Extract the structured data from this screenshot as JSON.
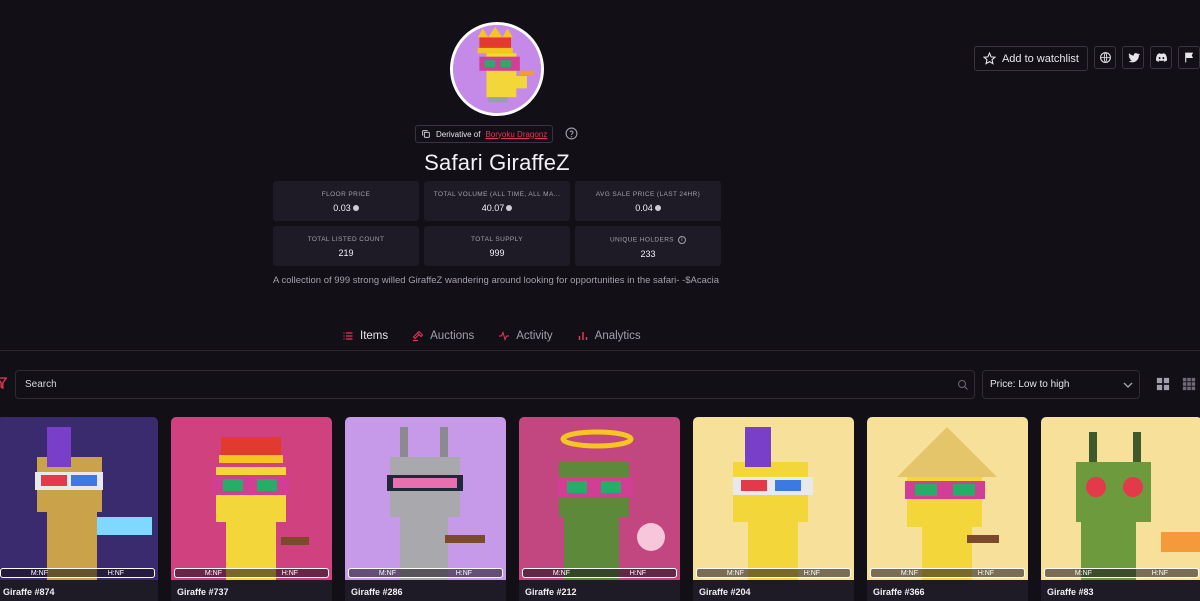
{
  "actions": {
    "watchlist_label": "Add to watchlist",
    "icons": [
      "globe-icon",
      "twitter-icon",
      "discord-icon",
      "flag-icon"
    ]
  },
  "collection": {
    "derivative_prefix": "Derivative of",
    "derivative_link": "Boryoku Dragonz",
    "title": "Safari GiraffeZ",
    "description": "A collection of 999 strong willed GiraffeZ wandering around looking for opportunities in the safari- -$Acacia"
  },
  "stats": [
    {
      "label": "FLOOR PRICE",
      "value": "0.03",
      "currency": true
    },
    {
      "label": "TOTAL VOLUME (ALL TIME, ALL MA...",
      "value": "40.07",
      "currency": true
    },
    {
      "label": "AVG SALE PRICE (LAST 24HR)",
      "value": "0.04",
      "currency": true
    },
    {
      "label": "TOTAL LISTED COUNT",
      "value": "219",
      "currency": false
    },
    {
      "label": "TOTAL SUPPLY",
      "value": "999",
      "currency": false
    },
    {
      "label": "UNIQUE HOLDERS",
      "value": "233",
      "currency": false
    }
  ],
  "tabs": [
    {
      "label": "Items",
      "active": true,
      "icon": "list-icon"
    },
    {
      "label": "Auctions",
      "active": false,
      "icon": "gavel-icon"
    },
    {
      "label": "Activity",
      "active": false,
      "icon": "pulse-icon"
    },
    {
      "label": "Analytics",
      "active": false,
      "icon": "bar-chart-icon"
    }
  ],
  "search": {
    "placeholder": "Search"
  },
  "sort": {
    "selected": "Price: Low to high"
  },
  "cards": [
    {
      "name": "Giraffe #874",
      "m": "M:NF",
      "h": "H:NF",
      "bg": "#3a2a6e",
      "skin": "#c9a24a"
    },
    {
      "name": "Giraffe #737",
      "m": "M:NF",
      "h": "H:NF",
      "bg": "#d0417f",
      "skin": "#f3d63a"
    },
    {
      "name": "Giraffe #286",
      "m": "M:NF",
      "h": "H:NF",
      "bg": "#c69ae8",
      "skin": "#a9a9ad"
    },
    {
      "name": "Giraffe #212",
      "m": "M:NF",
      "h": "H:NF",
      "bg": "#c2467f",
      "skin": "#5d8a3a"
    },
    {
      "name": "Giraffe #204",
      "m": "M:NF",
      "h": "H:NF",
      "bg": "#f6e09a",
      "skin": "#f3d63a"
    },
    {
      "name": "Giraffe #366",
      "m": "M:NF",
      "h": "H:NF",
      "bg": "#f6e09a",
      "skin": "#f3d63a"
    },
    {
      "name": "Giraffe #83",
      "m": "M:NF",
      "h": "H:NF",
      "bg": "#f6e09a",
      "skin": "#6e9a3e"
    }
  ],
  "colors": {
    "accent": "#e8375b",
    "background": "#120f17",
    "panel": "#1e1a26"
  }
}
